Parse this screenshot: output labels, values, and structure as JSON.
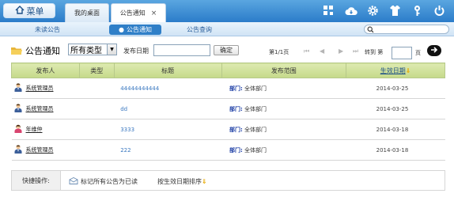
{
  "topbar": {
    "menu_label": "菜单",
    "tabs": [
      {
        "label": "我的桌面"
      },
      {
        "label": "公告通知",
        "close": "×"
      }
    ],
    "icons": [
      "grid-icon",
      "cloud-icon",
      "gear-icon",
      "shirt-icon",
      "key-icon",
      "power-icon"
    ]
  },
  "subnav": {
    "items": [
      {
        "label": "未读公告"
      },
      {
        "label": "公告通知"
      },
      {
        "label": "公告查询"
      }
    ],
    "search_placeholder": ""
  },
  "toolbar": {
    "title": "公告通知",
    "type_select": "所有类型",
    "date_label": "发布日期",
    "date_value": "",
    "ok_label": "确定",
    "page_info": "第1/1页",
    "goto_label": "转到 第",
    "page_value": "",
    "page_unit": "页"
  },
  "table": {
    "headers": [
      "发布人",
      "类型",
      "标题",
      "发布范围",
      "生效日期"
    ],
    "rows": [
      {
        "publisher": "系统管理员",
        "type": "",
        "title": "44444444444",
        "scope_key": "部门:",
        "scope_val": "全体部门",
        "date": "2014-03-25",
        "avatar": "male"
      },
      {
        "publisher": "系统管理员",
        "type": "",
        "title": "dd",
        "scope_key": "部门:",
        "scope_val": "全体部门",
        "date": "2014-03-25",
        "avatar": "male"
      },
      {
        "publisher": "年维仲",
        "type": "",
        "title": "3333",
        "scope_key": "部门:",
        "scope_val": "全体部门",
        "date": "2014-03-18",
        "avatar": "female"
      },
      {
        "publisher": "系统管理员",
        "type": "",
        "title": "222",
        "scope_key": "部门:",
        "scope_val": "全体部门",
        "date": "2014-03-18",
        "avatar": "male"
      }
    ]
  },
  "quickbar": {
    "label": "快捷操作:",
    "mark_read": "标记所有公告为已读",
    "sort": "按生效日期排序"
  }
}
